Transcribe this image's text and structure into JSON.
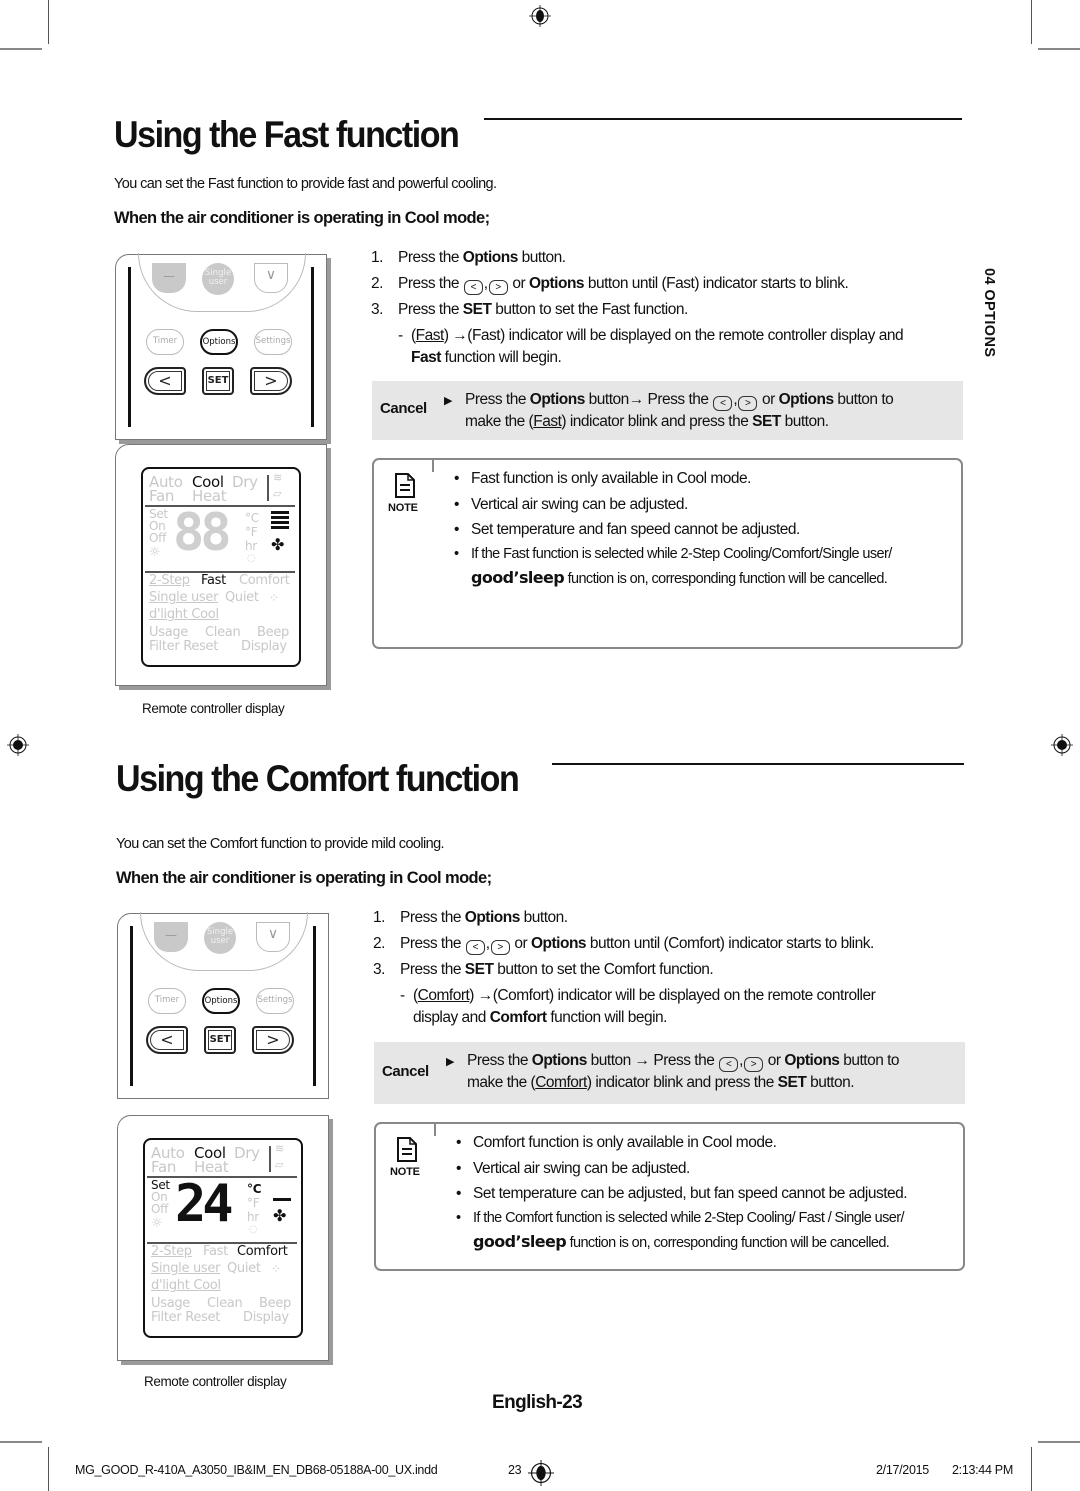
{
  "section_tab": "04  OPTIONS",
  "fast": {
    "title": "Using the Fast function",
    "intro": "You can set the Fast function to provide fast and powerful cooling.",
    "condition": "When the air conditioner is operating in Cool mode;",
    "steps": [
      {
        "num": "1.",
        "pre": "Press the ",
        "bold": "Options",
        "post": " button."
      },
      {
        "num": "2.",
        "pre": "Press the ",
        "mid": " or ",
        "bold": "Options",
        "post": " button until (Fast) indicator starts to blink."
      },
      {
        "num": "3.",
        "pre": "Press the ",
        "bold": "SET",
        "post": " button to set the Fast function."
      }
    ],
    "substep": {
      "dash": "-",
      "indicator": "Fast",
      "line1_rest": " →(Fast) indicator will be displayed on the remote controller display and",
      "line2_bold": "Fast",
      "line2_rest": " function will begin."
    },
    "cancel": {
      "label": "Cancel",
      "line1_a": "Press the ",
      "line1_b": "Options",
      "line1_c": " button→ Press the ",
      "line1_d": " or ",
      "line1_e": "Options",
      "line1_f": " button to",
      "line2_a": "make the (",
      "line2_u": "Fast",
      "line2_b": ") indicator blink and press the ",
      "line2_c": "SET",
      "line2_d": " button."
    },
    "note": {
      "label": "NOTE",
      "items": [
        "Fast function is only available in Cool mode.",
        "Vertical air swing can be adjusted.",
        "Set temperature and fan speed cannot be adjusted.",
        "If  the Fast function is selected while 2-Step Cooling/Comfort/Single user/"
      ],
      "good_sleep": "good’sleep",
      "last_rest": " function is on, corresponding function will be cancelled."
    },
    "display": {
      "digits": "88",
      "active_function": "Fast",
      "caption": "Remote controller display"
    }
  },
  "comfort": {
    "title": "Using the Comfort function",
    "intro": "You can set the Comfort function to provide mild cooling.",
    "condition": "When the air conditioner is operating in Cool mode;",
    "steps": [
      {
        "num": "1.",
        "pre": "Press the ",
        "bold": "Options",
        "post": " button."
      },
      {
        "num": "2.",
        "pre": "Press the ",
        "mid": " or ",
        "bold": "Options",
        "post": " button until (Comfort) indicator starts to blink."
      },
      {
        "num": "3.",
        "pre": "Press the ",
        "bold": "SET",
        "post": " button to set the Comfort function."
      }
    ],
    "substep": {
      "dash": "-",
      "indicator": "Comfort",
      "line1_rest": " →(Comfort) indicator will be displayed on the remote controller",
      "line2_pre": "display and ",
      "line2_bold": "Comfort",
      "line2_rest": " function will begin."
    },
    "cancel": {
      "label": "Cancel",
      "line1_a": "Press the ",
      "line1_b": "Options",
      "line1_c": " button → Press the ",
      "line1_d": " or ",
      "line1_e": "Options",
      "line1_f": " button to",
      "line2_a": "make the (",
      "line2_u": "Comfort",
      "line2_b": ") indicator blink and press the ",
      "line2_c": "SET",
      "line2_d": " button."
    },
    "note": {
      "label": "NOTE",
      "items": [
        "Comfort function is only available in Cool mode.",
        "Vertical air swing can be adjusted.",
        "Set temperature can be adjusted, but fan speed cannot be adjusted.",
        "If the Comfort function is selected while 2-Step Cooling/ Fast / Single user/"
      ],
      "good_sleep": "good’sleep",
      "last_rest": " function is on, corresponding function will be cancelled."
    },
    "display": {
      "digits": "24",
      "active_function": "Comfort",
      "caption": "Remote controller display"
    }
  },
  "remote": {
    "minus": "—",
    "single_user": [
      "Single",
      "user"
    ],
    "down": "∨",
    "timer": "Timer",
    "options": "Options",
    "settings": "Settings",
    "left": "<",
    "set": "SET",
    "right": ">"
  },
  "lcd": {
    "auto": "Auto",
    "cool": "Cool",
    "dry": "Dry",
    "fan": "Fan",
    "heat": "Heat",
    "set": "Set",
    "on": "On",
    "off": "Off",
    "celsius": "°C",
    "fahrenheit": "°F",
    "hr": "hr",
    "two_step": "2-Step",
    "fast": "Fast",
    "comfort": "Comfort",
    "single_user": "Single user",
    "quiet": "Quiet",
    "dlight_cool": "d'light Cool",
    "usage": "Usage",
    "clean": "Clean",
    "beep": "Beep",
    "filter_reset": "Filter Reset",
    "display": "Display"
  },
  "page_number": "English-23",
  "footer": {
    "file": "MG_GOOD_R-410A_A3050_IB&IM_EN_DB68-05188A-00_UX.indd",
    "page": "23",
    "date": "2/17/2015",
    "time": "2:13:44 PM"
  }
}
